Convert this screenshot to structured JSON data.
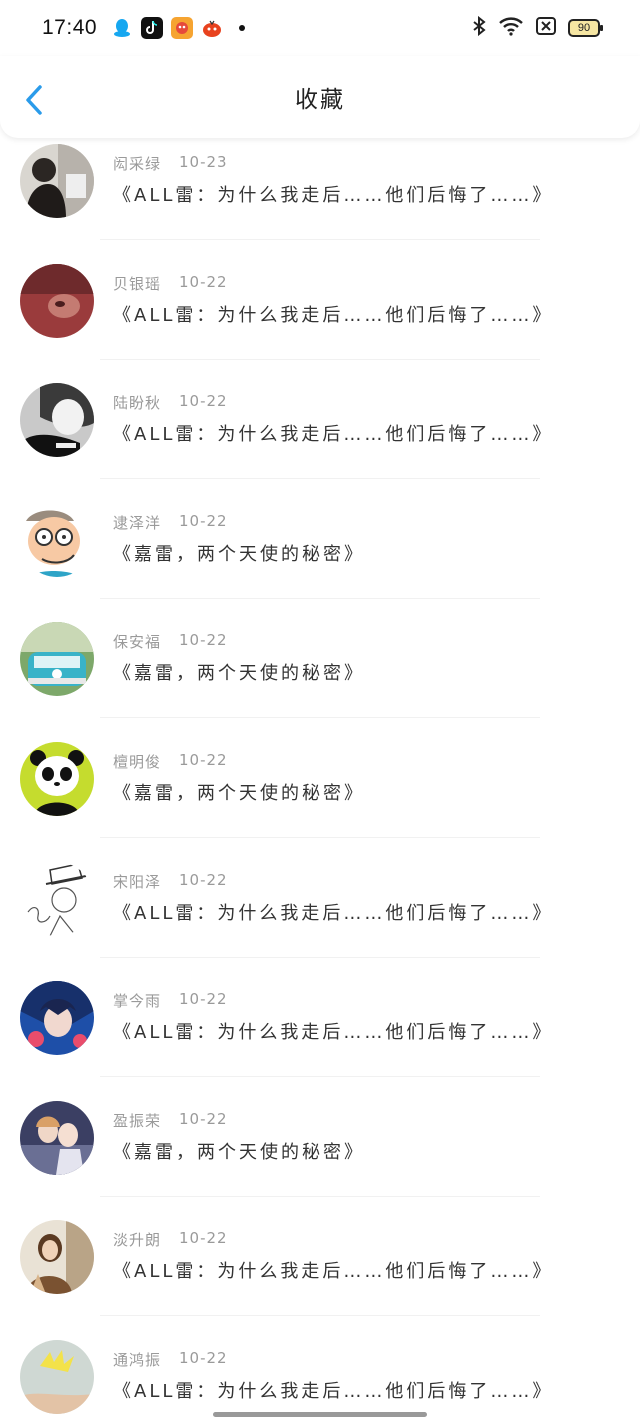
{
  "status_bar": {
    "time": "17:40",
    "battery": "90",
    "app_icons": [
      "qq-icon",
      "tiktok-icon",
      "game-icon",
      "game2-icon"
    ],
    "right_icons": [
      "bluetooth-icon",
      "wifi-icon",
      "sim-icon",
      "battery-icon"
    ]
  },
  "nav": {
    "title": "收藏",
    "back_icon": "chevron-left-icon"
  },
  "items": [
    {
      "name": "闳采绿",
      "date": "10-23",
      "title": "《ALL雷：为什么我走后……他们后悔了……》"
    },
    {
      "name": "贝银瑶",
      "date": "10-22",
      "title": "《ALL雷：为什么我走后……他们后悔了……》"
    },
    {
      "name": "陆盼秋",
      "date": "10-22",
      "title": "《ALL雷：为什么我走后……他们后悔了……》"
    },
    {
      "name": "逮泽洋",
      "date": "10-22",
      "title": "《嘉雷，两个天使的秘密》"
    },
    {
      "name": "保安福",
      "date": "10-22",
      "title": "《嘉雷，两个天使的秘密》"
    },
    {
      "name": "檀明俊",
      "date": "10-22",
      "title": "《嘉雷，两个天使的秘密》"
    },
    {
      "name": "宋阳泽",
      "date": "10-22",
      "title": "《ALL雷：为什么我走后……他们后悔了……》"
    },
    {
      "name": "掌今雨",
      "date": "10-22",
      "title": "《ALL雷：为什么我走后……他们后悔了……》"
    },
    {
      "name": "盈振荣",
      "date": "10-22",
      "title": "《嘉雷，两个天使的秘密》"
    },
    {
      "name": "淡升朗",
      "date": "10-22",
      "title": "《ALL雷：为什么我走后……他们后悔了……》"
    },
    {
      "name": "通鸿振",
      "date": "10-22",
      "title": "《ALL雷：为什么我走后……他们后悔了……》"
    }
  ],
  "colors": {
    "accent": "#2a9bea",
    "meta": "#9a9a9a"
  }
}
